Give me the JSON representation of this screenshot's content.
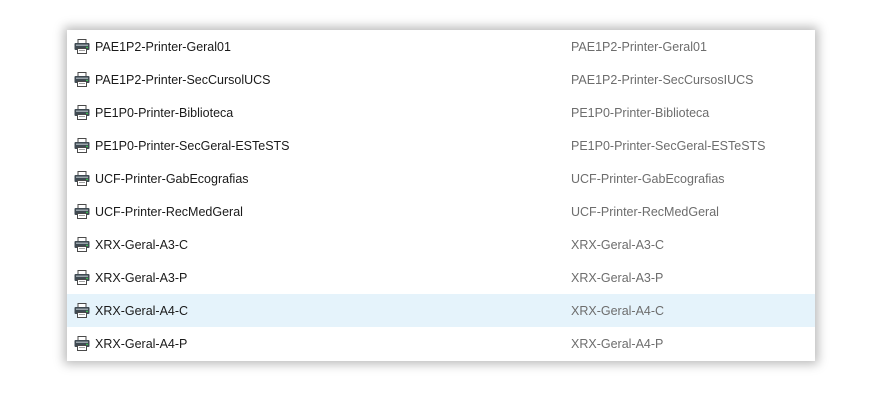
{
  "printers": [
    {
      "name": "PAE1P2-Printer-Geral01",
      "description": "PAE1P2-Printer-Geral01",
      "icon": "printer-icon",
      "selected": false
    },
    {
      "name": "PAE1P2-Printer-SecCursolUCS",
      "description": "PAE1P2-Printer-SecCursosIUCS",
      "icon": "printer-icon",
      "selected": false
    },
    {
      "name": "PE1P0-Printer-Biblioteca",
      "description": "PE1P0-Printer-Biblioteca",
      "icon": "printer-icon",
      "selected": false
    },
    {
      "name": "PE1P0-Printer-SecGeral-ESTeSTS",
      "description": "PE1P0-Printer-SecGeral-ESTeSTS",
      "icon": "printer-icon",
      "selected": false
    },
    {
      "name": "UCF-Printer-GabEcografias",
      "description": "UCF-Printer-GabEcografias",
      "icon": "printer-icon",
      "selected": false
    },
    {
      "name": "UCF-Printer-RecMedGeral",
      "description": "UCF-Printer-RecMedGeral",
      "icon": "printer-icon",
      "selected": false
    },
    {
      "name": "XRX-Geral-A3-C",
      "description": "XRX-Geral-A3-C",
      "icon": "printer-icon",
      "selected": false
    },
    {
      "name": "XRX-Geral-A3-P",
      "description": "XRX-Geral-A3-P",
      "icon": "printer-icon",
      "selected": false
    },
    {
      "name": "XRX-Geral-A4-C",
      "description": "XRX-Geral-A4-C",
      "icon": "printer-icon",
      "selected": true
    },
    {
      "name": "XRX-Geral-A4-P",
      "description": "XRX-Geral-A4-P",
      "icon": "printer-icon",
      "selected": false
    }
  ],
  "colors": {
    "selection": "#e5f3fb",
    "name_text": "#1a1a1a",
    "description_text": "#6d6d6d"
  }
}
